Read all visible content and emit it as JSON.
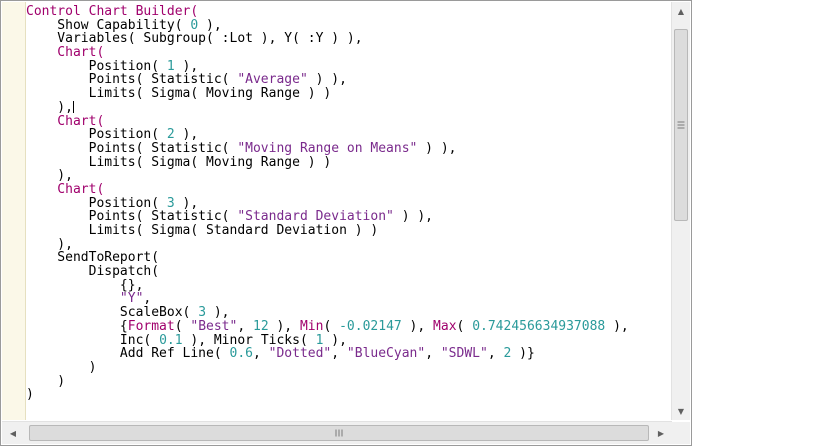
{
  "editor": {
    "lines": [
      [
        {
          "t": "Control Chart Builder(",
          "c": "kw"
        }
      ],
      [
        {
          "t": "    Show Capability( ",
          "c": "fn"
        },
        {
          "t": "0",
          "c": "num"
        },
        {
          "t": " ),",
          "c": "fn"
        }
      ],
      [
        {
          "t": "    Variables( Subgroup( :Lot ), Y( :Y ) ),",
          "c": "fn"
        }
      ],
      [
        {
          "t": "    Chart(",
          "c": "kw"
        }
      ],
      [
        {
          "t": "        Position( ",
          "c": "fn"
        },
        {
          "t": "1",
          "c": "num"
        },
        {
          "t": " ),",
          "c": "fn"
        }
      ],
      [
        {
          "t": "        Points( Statistic( ",
          "c": "fn"
        },
        {
          "t": "\"Average\"",
          "c": "str"
        },
        {
          "t": " ) ),",
          "c": "fn"
        }
      ],
      [
        {
          "t": "        Limits( Sigma( Moving Range ) )",
          "c": "fn"
        }
      ],
      [
        {
          "t": "    ),",
          "c": "fn"
        },
        {
          "caret": true
        }
      ],
      [
        {
          "t": "    Chart(",
          "c": "kw"
        }
      ],
      [
        {
          "t": "        Position( ",
          "c": "fn"
        },
        {
          "t": "2",
          "c": "num"
        },
        {
          "t": " ),",
          "c": "fn"
        }
      ],
      [
        {
          "t": "        Points( Statistic( ",
          "c": "fn"
        },
        {
          "t": "\"Moving Range on Means\"",
          "c": "str"
        },
        {
          "t": " ) ),",
          "c": "fn"
        }
      ],
      [
        {
          "t": "        Limits( Sigma( Moving Range ) )",
          "c": "fn"
        }
      ],
      [
        {
          "t": "    ),",
          "c": "fn"
        }
      ],
      [
        {
          "t": "    Chart(",
          "c": "kw"
        }
      ],
      [
        {
          "t": "        Position( ",
          "c": "fn"
        },
        {
          "t": "3",
          "c": "num"
        },
        {
          "t": " ),",
          "c": "fn"
        }
      ],
      [
        {
          "t": "        Points( Statistic( ",
          "c": "fn"
        },
        {
          "t": "\"Standard Deviation\"",
          "c": "str"
        },
        {
          "t": " ) ),",
          "c": "fn"
        }
      ],
      [
        {
          "t": "        Limits( Sigma( Standard Deviation ) )",
          "c": "fn"
        }
      ],
      [
        {
          "t": "    ),",
          "c": "fn"
        }
      ],
      [
        {
          "t": "    SendToReport(",
          "c": "fn"
        }
      ],
      [
        {
          "t": "        Dispatch(",
          "c": "fn"
        }
      ],
      [
        {
          "t": "            {},",
          "c": "fn"
        }
      ],
      [
        {
          "t": "            ",
          "c": "fn"
        },
        {
          "t": "\"Y\"",
          "c": "str"
        },
        {
          "t": ",",
          "c": "fn"
        }
      ],
      [
        {
          "t": "            ScaleBox( ",
          "c": "fn"
        },
        {
          "t": "3",
          "c": "num"
        },
        {
          "t": " ),",
          "c": "fn"
        }
      ],
      [
        {
          "t": "            {",
          "c": "fn"
        },
        {
          "t": "Format",
          "c": "kw"
        },
        {
          "t": "( ",
          "c": "fn"
        },
        {
          "t": "\"Best\"",
          "c": "str"
        },
        {
          "t": ", ",
          "c": "fn"
        },
        {
          "t": "12",
          "c": "num"
        },
        {
          "t": " ), ",
          "c": "fn"
        },
        {
          "t": "Min",
          "c": "kw"
        },
        {
          "t": "( ",
          "c": "fn"
        },
        {
          "t": "-0.02147",
          "c": "num"
        },
        {
          "t": " ), ",
          "c": "fn"
        },
        {
          "t": "Max",
          "c": "kw"
        },
        {
          "t": "( ",
          "c": "fn"
        },
        {
          "t": "0.742456634937088",
          "c": "num"
        },
        {
          "t": " ),",
          "c": "fn"
        }
      ],
      [
        {
          "t": "            Inc( ",
          "c": "fn"
        },
        {
          "t": "0.1",
          "c": "num"
        },
        {
          "t": " ), Minor Ticks( ",
          "c": "fn"
        },
        {
          "t": "1",
          "c": "num"
        },
        {
          "t": " ),",
          "c": "fn"
        }
      ],
      [
        {
          "t": "            Add Ref Line( ",
          "c": "fn"
        },
        {
          "t": "0.6",
          "c": "num"
        },
        {
          "t": ", ",
          "c": "fn"
        },
        {
          "t": "\"Dotted\"",
          "c": "str"
        },
        {
          "t": ", ",
          "c": "fn"
        },
        {
          "t": "\"BlueCyan\"",
          "c": "str"
        },
        {
          "t": ", ",
          "c": "fn"
        },
        {
          "t": "\"SDWL\"",
          "c": "str"
        },
        {
          "t": ", ",
          "c": "fn"
        },
        {
          "t": "2",
          "c": "num"
        },
        {
          "t": " )}",
          "c": "fn"
        }
      ],
      [
        {
          "t": "        )",
          "c": "fn"
        }
      ],
      [
        {
          "t": "    )",
          "c": "fn"
        }
      ],
      [
        {
          "t": ")",
          "c": "fn"
        }
      ]
    ]
  },
  "scrollbars": {
    "vertical": {
      "up_icon": "arrow-up-icon",
      "down_icon": "arrow-down-icon",
      "grip_icon": "grip-icon"
    },
    "horizontal": {
      "left_icon": "arrow-left-icon",
      "right_icon": "arrow-right-icon",
      "grip_icon": "grip-icon"
    }
  }
}
